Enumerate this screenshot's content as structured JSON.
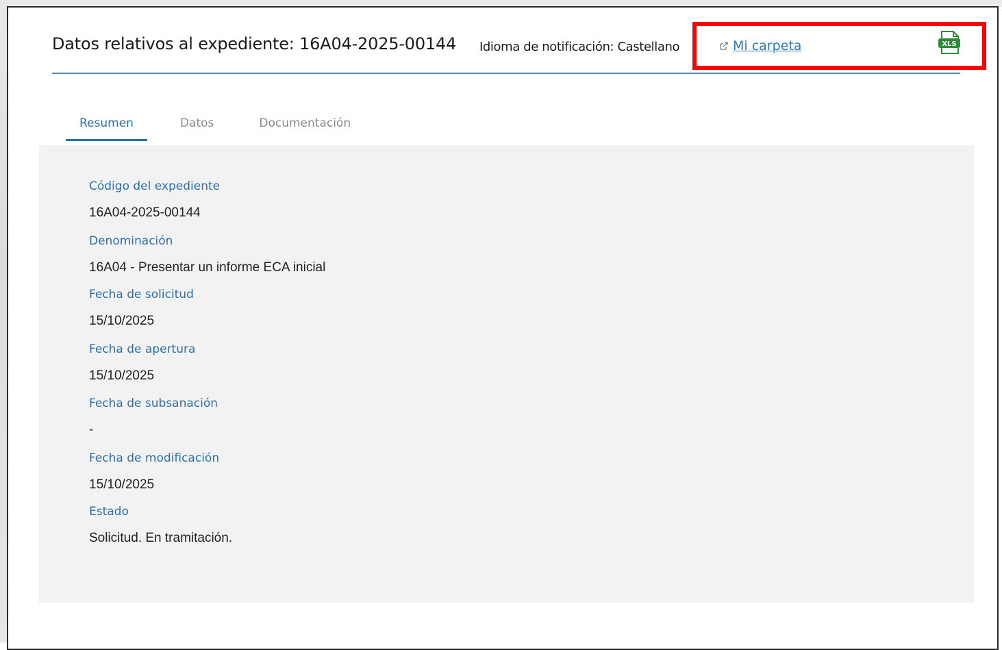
{
  "header": {
    "title": "Datos relativos al expediente: 16A04-2025-00144",
    "language": "Idioma de notificación: Castellano",
    "folder_link": "Mi carpeta",
    "xls_label": "XLS"
  },
  "tabs": [
    {
      "label": "Resumen",
      "active": true
    },
    {
      "label": "Datos",
      "active": false
    },
    {
      "label": "Documentación",
      "active": false
    }
  ],
  "fields": [
    {
      "label": "Código del expediente",
      "value": "16A04-2025-00144"
    },
    {
      "label": "Denominación",
      "value": "16A04 - Presentar un informe ECA inicial"
    },
    {
      "label": "Fecha de solicitud",
      "value": "15/10/2025"
    },
    {
      "label": "Fecha de apertura",
      "value": "15/10/2025"
    },
    {
      "label": "Fecha de subsanación",
      "value": "-"
    },
    {
      "label": "Fecha de modificación",
      "value": "15/10/2025"
    },
    {
      "label": "Estado",
      "value": "Solicitud. En tramitación."
    }
  ],
  "colors": {
    "accent": "#2d6fa8",
    "highlight": "#ff0000",
    "content_bg": "#f2f2f2",
    "xls_green": "#2e8b3a"
  }
}
